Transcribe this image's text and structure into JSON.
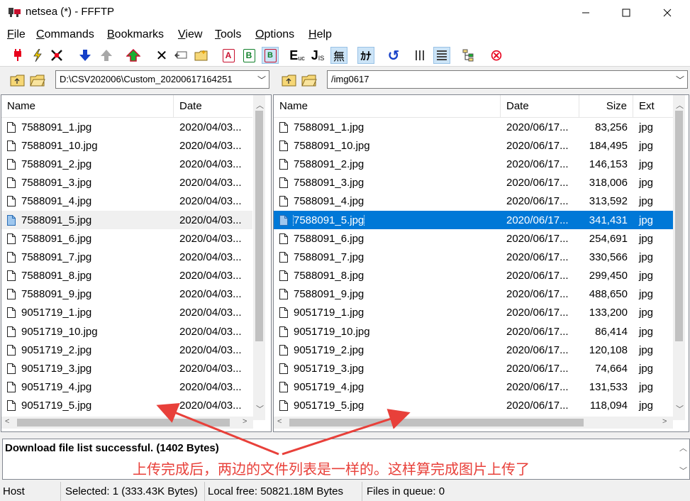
{
  "window": {
    "title": "netsea (*) - FFFTP",
    "minimize": "—",
    "maximize": "☐",
    "close": "✕"
  },
  "menu": [
    {
      "label": "File",
      "key": "F"
    },
    {
      "label": "Commands",
      "key": "C"
    },
    {
      "label": "Bookmarks",
      "key": "B"
    },
    {
      "label": "View",
      "key": "V"
    },
    {
      "label": "Tools",
      "key": "T"
    },
    {
      "label": "Options",
      "key": "O"
    },
    {
      "label": "Help",
      "key": "H"
    }
  ],
  "toolbar": {
    "connect_icon": "plug-icon",
    "quick_connect_icon": "lightning-icon",
    "disconnect_icon": "disconnect-icon",
    "download_icon": "download-arrow-icon",
    "upload_icon": "upload-arrow-icon",
    "mirror_upload_icon": "mirror-upload-icon",
    "delete_glyph": "✕",
    "rename_glyph": "⏎",
    "mkdir_icon": "new-folder-icon",
    "ascii_label": "A",
    "binary_label": "B",
    "auto_label": "B",
    "euc_label": "E",
    "jis_label": "J",
    "no_conv_label": "無",
    "kana_label": "ｶﾅ",
    "refresh_glyph": "↺",
    "list_glyph": "⁞⁞⁞",
    "detail_glyph": "▦",
    "sync_icon": "sync-tree-icon",
    "stop_glyph": "⊗"
  },
  "local": {
    "path": "D:\\CSV202006\\Custom_20200617164251",
    "columns": [
      "Name",
      "Date"
    ],
    "files": [
      {
        "name": "7588091_1.jpg",
        "date": "2020/04/03..."
      },
      {
        "name": "7588091_10.jpg",
        "date": "2020/04/03..."
      },
      {
        "name": "7588091_2.jpg",
        "date": "2020/04/03..."
      },
      {
        "name": "7588091_3.jpg",
        "date": "2020/04/03..."
      },
      {
        "name": "7588091_4.jpg",
        "date": "2020/04/03..."
      },
      {
        "name": "7588091_5.jpg",
        "date": "2020/04/03...",
        "selected": true
      },
      {
        "name": "7588091_6.jpg",
        "date": "2020/04/03..."
      },
      {
        "name": "7588091_7.jpg",
        "date": "2020/04/03..."
      },
      {
        "name": "7588091_8.jpg",
        "date": "2020/04/03..."
      },
      {
        "name": "7588091_9.jpg",
        "date": "2020/04/03..."
      },
      {
        "name": "9051719_1.jpg",
        "date": "2020/04/03..."
      },
      {
        "name": "9051719_10.jpg",
        "date": "2020/04/03..."
      },
      {
        "name": "9051719_2.jpg",
        "date": "2020/04/03..."
      },
      {
        "name": "9051719_3.jpg",
        "date": "2020/04/03..."
      },
      {
        "name": "9051719_4.jpg",
        "date": "2020/04/03..."
      },
      {
        "name": "9051719_5.jpg",
        "date": "2020/04/03..."
      }
    ]
  },
  "remote": {
    "path": "/img0617",
    "columns": [
      "Name",
      "Date",
      "Size",
      "Ext"
    ],
    "files": [
      {
        "name": "7588091_1.jpg",
        "date": "2020/06/17...",
        "size": "83,256",
        "ext": "jpg"
      },
      {
        "name": "7588091_10.jpg",
        "date": "2020/06/17...",
        "size": "184,495",
        "ext": "jpg"
      },
      {
        "name": "7588091_2.jpg",
        "date": "2020/06/17...",
        "size": "146,153",
        "ext": "jpg"
      },
      {
        "name": "7588091_3.jpg",
        "date": "2020/06/17...",
        "size": "318,006",
        "ext": "jpg"
      },
      {
        "name": "7588091_4.jpg",
        "date": "2020/06/17...",
        "size": "313,592",
        "ext": "jpg"
      },
      {
        "name": "7588091_5.jpg",
        "date": "2020/06/17...",
        "size": "341,431",
        "ext": "jpg",
        "selected": true
      },
      {
        "name": "7588091_6.jpg",
        "date": "2020/06/17...",
        "size": "254,691",
        "ext": "jpg"
      },
      {
        "name": "7588091_7.jpg",
        "date": "2020/06/17...",
        "size": "330,566",
        "ext": "jpg"
      },
      {
        "name": "7588091_8.jpg",
        "date": "2020/06/17...",
        "size": "299,450",
        "ext": "jpg"
      },
      {
        "name": "7588091_9.jpg",
        "date": "2020/06/17...",
        "size": "488,650",
        "ext": "jpg"
      },
      {
        "name": "9051719_1.jpg",
        "date": "2020/06/17...",
        "size": "133,200",
        "ext": "jpg"
      },
      {
        "name": "9051719_10.jpg",
        "date": "2020/06/17...",
        "size": "86,414",
        "ext": "jpg"
      },
      {
        "name": "9051719_2.jpg",
        "date": "2020/06/17...",
        "size": "120,108",
        "ext": "jpg"
      },
      {
        "name": "9051719_3.jpg",
        "date": "2020/06/17...",
        "size": "74,664",
        "ext": "jpg"
      },
      {
        "name": "9051719_4.jpg",
        "date": "2020/06/17...",
        "size": "131,533",
        "ext": "jpg"
      },
      {
        "name": "9051719_5.jpg",
        "date": "2020/06/17...",
        "size": "118,094",
        "ext": "jpg"
      }
    ]
  },
  "log": {
    "line": "Download file list successful. (1402 Bytes)",
    "annotation": "上传完成后，两边的文件列表是一样的。这样算完成图片上传了"
  },
  "status": {
    "host": "Host",
    "selected": "Selected: 1 (333.43K Bytes)",
    "local_free": "Local free: 50821.18M Bytes",
    "queue": "Files in queue: 0"
  },
  "colors": {
    "selection": "#0078d7",
    "annotation": "#e8403a"
  }
}
